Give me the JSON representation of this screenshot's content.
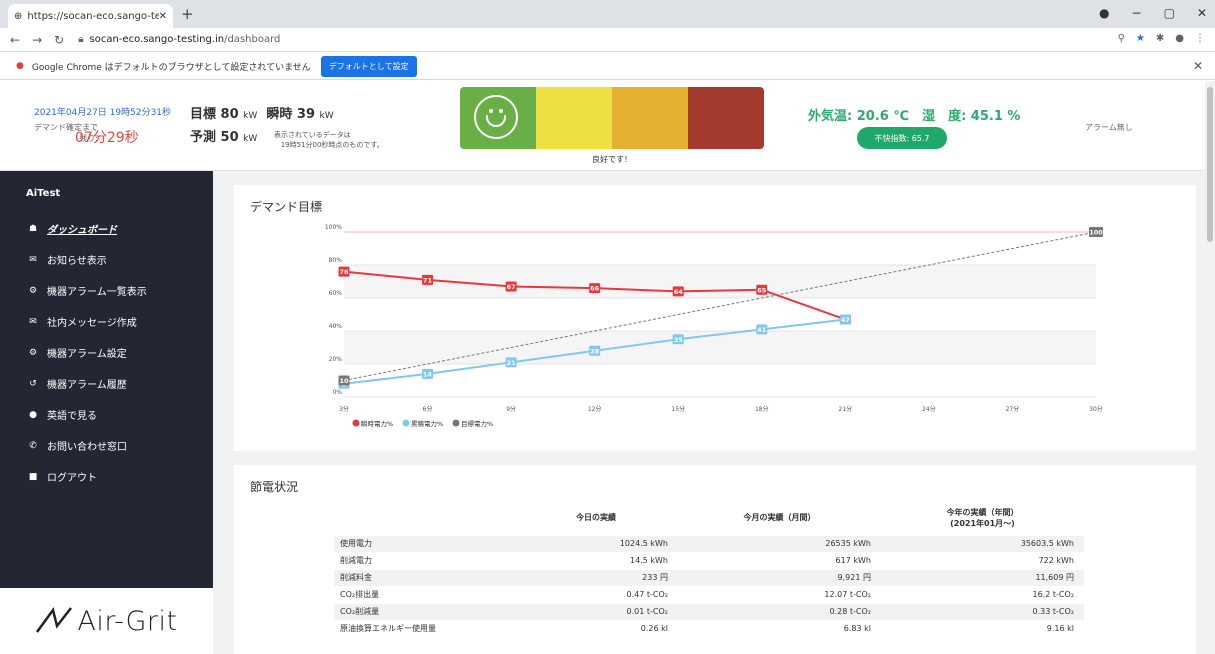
{
  "browser": {
    "tab_title": "https://socan-eco.sango-testing.",
    "url_host": "socan-eco.sango-testing.in",
    "url_path": "/dashboard",
    "infobar_text": "Google Chrome はデフォルトのブラウザとして設定されていません",
    "infobar_button": "デフォルトとして設定"
  },
  "header": {
    "datetime": "2021年04月27日 19時52分31秒",
    "demand_label_1": "デマンド確定まで",
    "demand_label_2": "残り:",
    "countdown": "07分29秒",
    "target_label": "目標",
    "target_value": "80",
    "target_unit": "kW",
    "instant_label": "瞬時",
    "instant_value": "39",
    "instant_unit": "kW",
    "forecast_label": "予測",
    "forecast_value": "50",
    "forecast_unit": "kW",
    "note_1": "表示されているデータは",
    "note_2": "19時51分00秒時点のものです。",
    "gauge_label": "良好です！",
    "weather": "外気温: 20.6 ℃　湿　度: 45.1 %",
    "discomfort": "不快指数: 65.7",
    "alarm": "アラーム無し",
    "gauge_colors": [
      "#6aaf45",
      "#eee043",
      "#e3b02f",
      "#a33a2d"
    ]
  },
  "sidebar": {
    "brand": "AiTest",
    "items": [
      {
        "icon": "home-icon",
        "glyph": "☗",
        "label": "ダッシュボード"
      },
      {
        "icon": "mail-icon",
        "glyph": "✉",
        "label": "お知らせ表示"
      },
      {
        "icon": "gear-icon",
        "glyph": "⚙",
        "label": "機器アラーム一覧表示"
      },
      {
        "icon": "mail-icon",
        "glyph": "✉",
        "label": "社内メッセージ作成"
      },
      {
        "icon": "gear-icon",
        "glyph": "⚙",
        "label": "機器アラーム設定"
      },
      {
        "icon": "history-icon",
        "glyph": "↺",
        "label": "機器アラーム履歴"
      },
      {
        "icon": "globe-icon",
        "glyph": "●",
        "label": "英語で見る"
      },
      {
        "icon": "phone-icon",
        "glyph": "✆",
        "label": "お問い合わせ窓口"
      },
      {
        "icon": "logout-icon",
        "glyph": "■",
        "label": "ログアウト"
      }
    ],
    "logo_text": "Air-Grit"
  },
  "chart_title": "デマンド目標",
  "chart_data": {
    "type": "line",
    "x": [
      "3分",
      "6分",
      "9分",
      "12分",
      "15分",
      "18分",
      "21分",
      "24分",
      "27分",
      "30分"
    ],
    "y_ticks": [
      "0%",
      "20%",
      "40%",
      "60%",
      "80%",
      "100%"
    ],
    "ylim": [
      0,
      100
    ],
    "series": [
      {
        "name": "瞬時電力%",
        "color": "#e8383d",
        "points": [
          [
            3,
            76
          ],
          [
            6,
            71
          ],
          [
            9,
            67
          ],
          [
            12,
            66
          ],
          [
            15,
            64
          ],
          [
            18,
            65
          ],
          [
            21,
            47
          ]
        ]
      },
      {
        "name": "累積電力%",
        "color": "#82c8ec",
        "points": [
          [
            3,
            8
          ],
          [
            6,
            14
          ],
          [
            9,
            21
          ],
          [
            12,
            28
          ],
          [
            15,
            35
          ],
          [
            18,
            41
          ],
          [
            21,
            47
          ]
        ]
      },
      {
        "name": "目標電力%",
        "color": "#777777",
        "dashed": true,
        "points": [
          [
            3,
            10
          ],
          [
            30,
            100
          ]
        ]
      }
    ],
    "legend": "bottom-left"
  },
  "savings": {
    "title": "節電状況",
    "headers": [
      "",
      "今日の実績",
      "今月の実績（月間）",
      "今年の実績（年間）"
    ],
    "header_sub": "(2021年01月〜)",
    "rows": [
      [
        "使用電力",
        "1024.5 kWh",
        "26535 kWh",
        "35603.5 kWh"
      ],
      [
        "削減電力",
        "14.5 kWh",
        "617 kWh",
        "722 kWh"
      ],
      [
        "削減料金",
        "233 円",
        "9,921 円",
        "11,609 円"
      ],
      [
        "CO₂排出量",
        "0.47 t-CO₂",
        "12.07 t-CO₂",
        "16.2 t-CO₂"
      ],
      [
        "CO₂削減量",
        "0.01 t-CO₂",
        "0.28 t-CO₂",
        "0.33 t-CO₂"
      ],
      [
        "原油換算エネルギー使用量",
        "0.26 kl",
        "6.83 kl",
        "9.16 kl"
      ]
    ]
  }
}
